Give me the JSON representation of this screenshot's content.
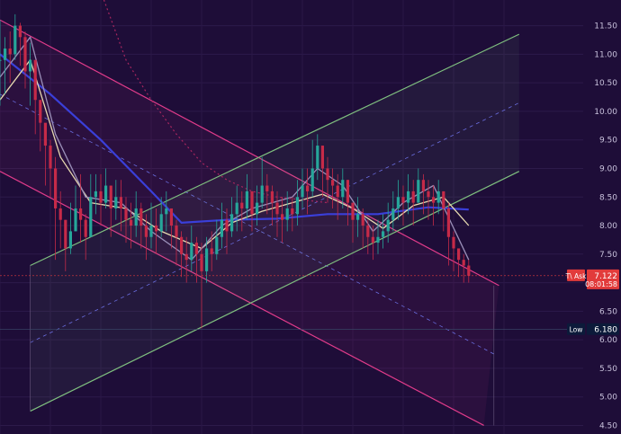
{
  "chart_data": {
    "type": "candlestick",
    "y_axis": {
      "ticks": [
        11.5,
        11.0,
        10.5,
        10.0,
        9.5,
        9.0,
        8.5,
        8.0,
        7.5,
        7.0,
        6.5,
        6.0,
        5.5,
        5.0,
        4.5
      ],
      "tick_labels": [
        "11.50",
        "11.00",
        "10.50",
        "10.00",
        "9.50",
        "9.00",
        "8.50",
        "8.00",
        "7.50",
        "7.00",
        "6.50",
        "6.00",
        "5.50",
        "5.00",
        "4.50"
      ],
      "ylim": [
        4.35,
        11.95
      ]
    },
    "x_range": [
      0,
      100
    ],
    "grid": true,
    "price_markers": [
      {
        "tag": "T\\ Ask",
        "value": 7.122,
        "label": "7.122",
        "sublabel": "08:01:58",
        "color": "#e23b3b"
      },
      {
        "tag": "Low",
        "value": 6.18,
        "label": "6.180",
        "color": "#0c1a3a"
      }
    ],
    "candles_close": [
      10.9,
      11.1,
      11.0,
      11.5,
      11.3,
      10.7,
      10.9,
      10.2,
      9.8,
      9.4,
      9.0,
      8.3,
      8.1,
      7.6,
      7.9,
      8.3,
      8.1,
      7.8,
      8.5,
      8.6,
      8.4,
      8.7,
      8.3,
      8.5,
      8.3,
      8.1,
      8.0,
      8.3,
      8.0,
      7.8,
      8.0,
      7.9,
      8.2,
      8.3,
      8.0,
      7.8,
      7.5,
      7.4,
      7.7,
      7.5,
      7.2,
      7.6,
      7.5,
      7.8,
      8.1,
      7.9,
      8.2,
      8.4,
      8.3,
      8.6,
      8.2,
      8.4,
      8.7,
      8.6,
      8.4,
      8.2,
      8.1,
      8.3,
      8.2,
      8.5,
      8.7,
      8.6,
      9.0,
      9.4,
      9.0,
      8.8,
      8.7,
      8.5,
      8.8,
      8.4,
      8.1,
      8.2,
      8.0,
      7.8,
      7.7,
      7.8,
      7.9,
      8.1,
      8.3,
      8.5,
      8.4,
      8.6,
      8.4,
      8.8,
      8.6,
      8.5,
      8.4,
      8.6,
      8.3,
      7.8,
      7.6,
      7.4,
      7.3,
      7.122
    ],
    "candles_range": [
      [
        10.1,
        11.6
      ],
      [
        10.3,
        11.3
      ],
      [
        10.5,
        11.4
      ],
      [
        10.9,
        11.7
      ],
      [
        10.8,
        11.55
      ],
      [
        10.4,
        11.4
      ],
      [
        10.1,
        11.2
      ],
      [
        9.6,
        10.7
      ],
      [
        9.3,
        10.2
      ],
      [
        8.7,
        9.7
      ],
      [
        8.5,
        9.5
      ],
      [
        7.4,
        9.2
      ],
      [
        7.6,
        8.6
      ],
      [
        7.2,
        8.1
      ],
      [
        7.5,
        8.4
      ],
      [
        7.9,
        8.7
      ],
      [
        7.7,
        8.9
      ],
      [
        7.4,
        8.2
      ],
      [
        8.0,
        8.9
      ],
      [
        8.2,
        8.9
      ],
      [
        8.0,
        8.9
      ],
      [
        8.3,
        9.0
      ],
      [
        7.8,
        8.7
      ],
      [
        8.1,
        8.8
      ],
      [
        7.9,
        8.8
      ],
      [
        7.7,
        8.5
      ],
      [
        7.6,
        8.4
      ],
      [
        7.8,
        8.6
      ],
      [
        7.6,
        8.4
      ],
      [
        7.4,
        8.2
      ],
      [
        7.6,
        8.4
      ],
      [
        7.5,
        8.3
      ],
      [
        7.8,
        8.5
      ],
      [
        7.9,
        8.6
      ],
      [
        7.6,
        8.3
      ],
      [
        7.3,
        8.1
      ],
      [
        7.1,
        7.9
      ],
      [
        7.0,
        7.8
      ],
      [
        7.2,
        8.0
      ],
      [
        7.0,
        7.8
      ],
      [
        6.2,
        7.7
      ],
      [
        7.0,
        7.8
      ],
      [
        7.2,
        7.9
      ],
      [
        7.4,
        8.1
      ],
      [
        7.6,
        8.4
      ],
      [
        7.5,
        8.3
      ],
      [
        7.8,
        8.5
      ],
      [
        7.9,
        8.7
      ],
      [
        7.9,
        8.6
      ],
      [
        8.1,
        8.9
      ],
      [
        7.9,
        8.6
      ],
      [
        8.0,
        8.7
      ],
      [
        8.3,
        9.2
      ],
      [
        8.2,
        8.9
      ],
      [
        8.0,
        8.7
      ],
      [
        7.8,
        8.6
      ],
      [
        7.7,
        8.5
      ],
      [
        7.9,
        8.6
      ],
      [
        7.9,
        8.5
      ],
      [
        8.0,
        8.8
      ],
      [
        8.3,
        9.0
      ],
      [
        8.2,
        9.0
      ],
      [
        8.5,
        9.5
      ],
      [
        8.8,
        9.6
      ],
      [
        8.5,
        9.4
      ],
      [
        8.4,
        9.2
      ],
      [
        8.3,
        9.0
      ],
      [
        8.1,
        8.9
      ],
      [
        8.3,
        9.0
      ],
      [
        8.0,
        8.8
      ],
      [
        7.7,
        8.4
      ],
      [
        7.8,
        8.5
      ],
      [
        7.6,
        8.3
      ],
      [
        7.5,
        8.1
      ],
      [
        7.4,
        8.0
      ],
      [
        7.5,
        8.1
      ],
      [
        7.6,
        8.2
      ],
      [
        7.7,
        8.4
      ],
      [
        7.9,
        8.6
      ],
      [
        8.1,
        8.8
      ],
      [
        8.0,
        8.7
      ],
      [
        8.2,
        8.9
      ],
      [
        8.0,
        8.8
      ],
      [
        8.4,
        9.0
      ],
      [
        8.2,
        8.9
      ],
      [
        8.1,
        8.8
      ],
      [
        8.0,
        8.7
      ],
      [
        8.2,
        8.8
      ],
      [
        7.9,
        8.6
      ],
      [
        7.3,
        8.4
      ],
      [
        7.2,
        7.9
      ],
      [
        7.1,
        7.6
      ],
      [
        7.0,
        7.5
      ],
      [
        7.0,
        7.4
      ]
    ],
    "moving_averages": [
      {
        "color": "#3a3fd9",
        "values": [
          [
            0,
            11.0
          ],
          [
            10,
            10.3
          ],
          [
            20,
            9.5
          ],
          [
            30,
            8.6
          ],
          [
            36,
            8.05
          ],
          [
            45,
            8.1
          ],
          [
            55,
            8.12
          ],
          [
            65,
            8.2
          ],
          [
            75,
            8.2
          ],
          [
            85,
            8.32
          ],
          [
            93,
            8.28
          ]
        ]
      },
      {
        "color": "#e6d9b0",
        "values": [
          [
            0,
            10.2
          ],
          [
            6,
            10.9
          ],
          [
            12,
            9.2
          ],
          [
            18,
            8.4
          ],
          [
            25,
            8.3
          ],
          [
            32,
            7.9
          ],
          [
            40,
            7.6
          ],
          [
            46,
            8.05
          ],
          [
            52,
            8.25
          ],
          [
            58,
            8.4
          ],
          [
            64,
            8.55
          ],
          [
            70,
            8.3
          ],
          [
            76,
            7.95
          ],
          [
            82,
            8.35
          ],
          [
            88,
            8.5
          ],
          [
            93,
            8.0
          ]
        ]
      },
      {
        "color": "#9a8fb8",
        "values": [
          [
            0,
            10.6
          ],
          [
            6,
            11.3
          ],
          [
            11,
            9.6
          ],
          [
            17,
            8.5
          ],
          [
            24,
            8.4
          ],
          [
            30,
            7.9
          ],
          [
            38,
            7.4
          ],
          [
            44,
            8.0
          ],
          [
            50,
            8.3
          ],
          [
            58,
            8.5
          ],
          [
            63,
            9.0
          ],
          [
            68,
            8.7
          ],
          [
            74,
            7.9
          ],
          [
            80,
            8.4
          ],
          [
            86,
            8.7
          ],
          [
            93,
            7.4
          ]
        ]
      },
      {
        "color": "#a8265f",
        "dashed": true,
        "values": [
          [
            20,
            12.1
          ],
          [
            25,
            10.9
          ],
          [
            30,
            10.2
          ],
          [
            35,
            9.6
          ],
          [
            40,
            9.1
          ],
          [
            45,
            8.8
          ],
          [
            50,
            8.6
          ],
          [
            55,
            8.5
          ],
          [
            60,
            8.45
          ],
          [
            65,
            8.4
          ]
        ]
      }
    ],
    "channels": [
      {
        "color": "#e03b8a",
        "upper": [
          [
            0,
            11.6
          ],
          [
            99,
            6.95
          ]
        ],
        "lower": [
          [
            0,
            8.95
          ],
          [
            96,
            4.5
          ]
        ],
        "mid": [
          [
            0,
            10.3
          ],
          [
            98,
            5.75
          ]
        ],
        "fill_end_x": 98
      },
      {
        "color": "#7fbf7f",
        "upper": [
          [
            6,
            7.3
          ],
          [
            103,
            11.35
          ]
        ],
        "lower": [
          [
            6,
            4.75
          ],
          [
            103,
            8.95
          ]
        ],
        "mid": [
          [
            6,
            5.95
          ],
          [
            103,
            10.15
          ]
        ],
        "fill_start_x": 6
      }
    ]
  }
}
